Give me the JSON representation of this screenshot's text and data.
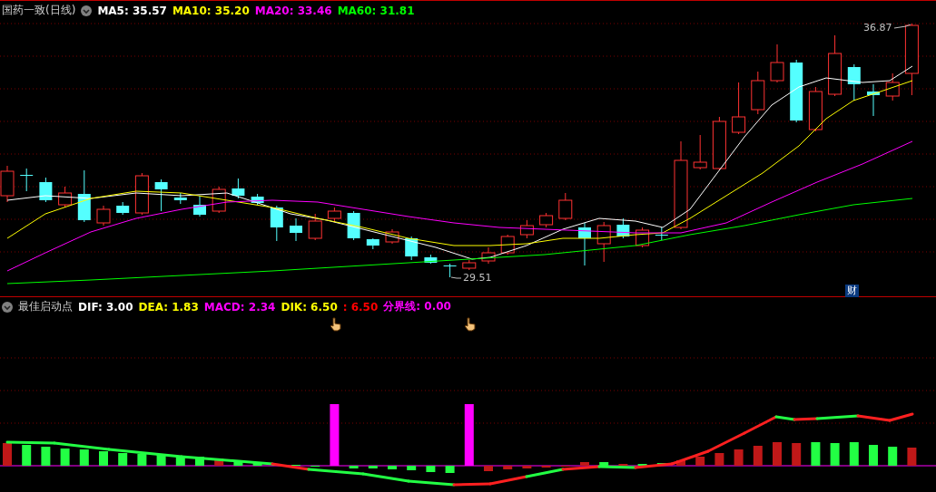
{
  "price_panel": {
    "title": "国药一致(日线)",
    "indicators": [
      {
        "label": "MA5: 35.57",
        "color": "#ffffff"
      },
      {
        "label": "MA10: 35.20",
        "color": "#ffff00"
      },
      {
        "label": "MA20: 33.46",
        "color": "#ff00ff"
      },
      {
        "label": "MA60: 31.81",
        "color": "#00ff00"
      }
    ],
    "high_label": "36.87",
    "low_label": "29.51",
    "badge": "财"
  },
  "indicator_panel": {
    "title": "最佳启动点",
    "indicators": [
      {
        "label": "DIF: 3.00",
        "color": "#ffffff"
      },
      {
        "label": "DEA: 1.83",
        "color": "#ffff00"
      },
      {
        "label": "MACD: 2.34",
        "color": "#ff00ff"
      },
      {
        "label": "DIK: 6.50",
        "color": "#ffff00"
      },
      {
        "label": ": 6.50",
        "color": "#ff0000"
      },
      {
        "label": "分界线: 0.00",
        "color": "#ff00ff"
      }
    ]
  }
}
